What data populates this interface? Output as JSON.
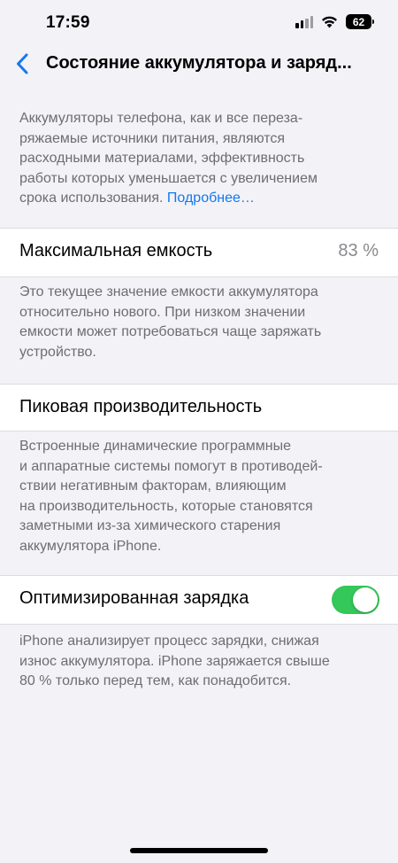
{
  "status_bar": {
    "time": "17:59",
    "battery_level": "62",
    "signal_bars": 4,
    "icons": [
      "signal-icon",
      "wifi-icon",
      "battery-icon"
    ]
  },
  "nav": {
    "back_icon": "chevron-left-icon",
    "title": "Состояние аккумулятора и заряд..."
  },
  "intro": {
    "lines": [
      "Аккумуляторы телефона, как и все переза-",
      "ряжаемые источники питания, являются",
      "расходными материалами, эффективность",
      "работы которых уменьшается с увеличением"
    ],
    "last_line": "срока использования.",
    "link": "Подробнее…"
  },
  "max_capacity": {
    "label": "Максимальная емкость",
    "value": "83 %",
    "footnote_lines": [
      "Это текущее значение емкости аккумулятора",
      "относительно нового. При низком значении",
      "емкости может потребоваться чаще заряжать",
      "устройство."
    ]
  },
  "peak_performance": {
    "label": "Пиковая производительность",
    "footnote_lines": [
      "Встроенные динамические программные",
      "и аппаратные системы помогут в противодей-",
      "ствии негативным факторам, влияющим",
      "на производительность, которые становятся",
      "заметными из-за химического старения",
      "аккумулятора iPhone."
    ]
  },
  "optimized_charging": {
    "label": "Оптимизированная зарядка",
    "enabled": true,
    "footnote_lines": [
      "iPhone анализирует процесс зарядки, снижая",
      "износ аккумулятора. iPhone заряжается свыше",
      "80 % только перед тем, как понадобится."
    ]
  },
  "colors": {
    "background": "#f2f2f7",
    "accent_link": "#1478f0",
    "toggle_on": "#34c759",
    "secondary_text": "#6d6d72"
  }
}
